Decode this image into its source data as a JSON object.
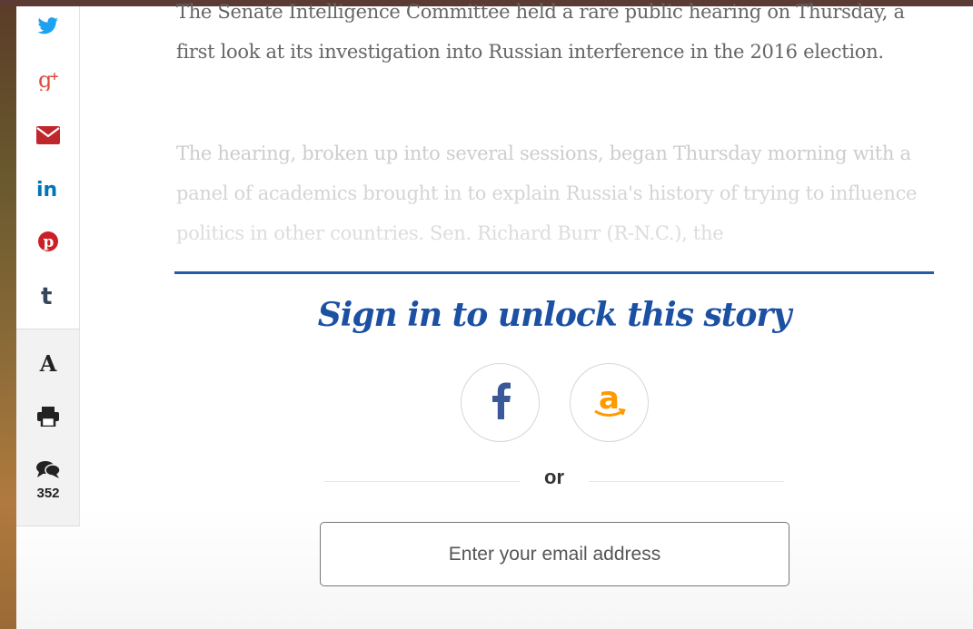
{
  "article": {
    "paragraph1": "The Senate Intelligence Committee held a rare public hearing on Thursday, a first look at its investigation into Russian interference in the 2016 election.",
    "paragraph2": "The hearing, broken up into several sessions, began Thursday morning with a panel of academics brought in to explain Russia's history of trying to influence politics in other countries. Sen. Richard Burr (R-N.C.), the"
  },
  "share_rail": {
    "items": [
      {
        "name": "twitter-icon",
        "color": "#1da1f2"
      },
      {
        "name": "google-plus-icon",
        "color": "#dd4b39"
      },
      {
        "name": "email-icon",
        "color": "#c0272d"
      },
      {
        "name": "linkedin-icon",
        "color": "#0077b5"
      },
      {
        "name": "pinterest-icon",
        "color": "#cb2027"
      },
      {
        "name": "tumblr-icon",
        "color": "#35465c"
      }
    ],
    "tools": {
      "text_size_label": "A",
      "print_icon": "print-icon",
      "comments_icon": "comments-icon",
      "comments_count": "352"
    }
  },
  "paywall": {
    "title": "Sign in to unlock this story",
    "providers": [
      {
        "name": "facebook-icon",
        "color": "#3b5998"
      },
      {
        "name": "amazon-icon",
        "color": "#ff9900"
      }
    ],
    "divider_text": "or",
    "email_placeholder": "Enter your email address"
  },
  "colors": {
    "accent_blue": "#1c50a3",
    "rule_blue": "#2a5aa6"
  }
}
